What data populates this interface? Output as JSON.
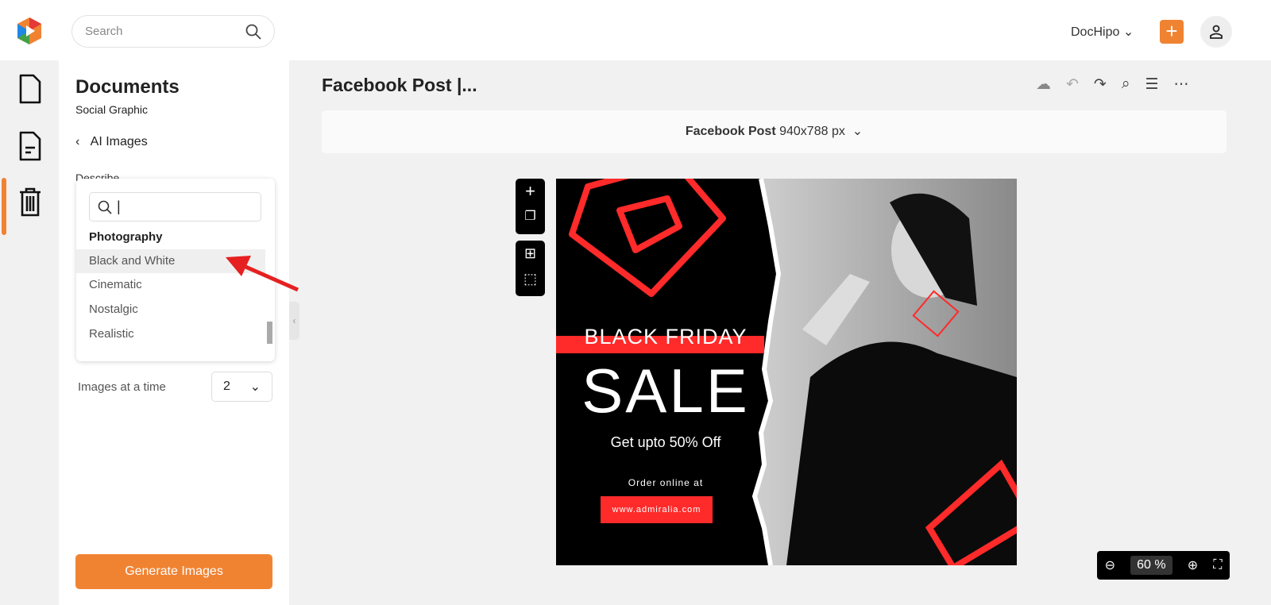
{
  "header": {
    "search_placeholder": "Search",
    "account": "DocHipo",
    "account_chevron": "⌄"
  },
  "sidebar": {
    "items": [
      {
        "icon": "file-icon"
      },
      {
        "icon": "document-icon",
        "active": true
      },
      {
        "icon": "trash-icon"
      }
    ]
  },
  "panel": {
    "title": "Documents",
    "subtitle": "Social Graphic",
    "back_label": "AI Images",
    "describe_label": "Describe",
    "dropdown": {
      "search_value": "|",
      "group": "Photography",
      "options": [
        "Black and White",
        "Cinematic",
        "Nostalgic",
        "Realistic"
      ],
      "highlighted": "Black and White"
    },
    "images_label": "Images at a time",
    "images_value": "2",
    "generate_label": "Generate Images"
  },
  "editor": {
    "doc_title": "Facebook Post |...",
    "size_name": "Facebook Post",
    "size_dims": "940x788 px",
    "zoom": "60",
    "zoom_unit": "%"
  },
  "design": {
    "line1": "BLACK FRIDAY",
    "line2": "SALE",
    "line3": "Get upto 50% Off",
    "line4": "Order online at",
    "url": "www.admiralia.com"
  },
  "colors": {
    "accent": "#f08332",
    "design_red": "#ff2a2a"
  }
}
